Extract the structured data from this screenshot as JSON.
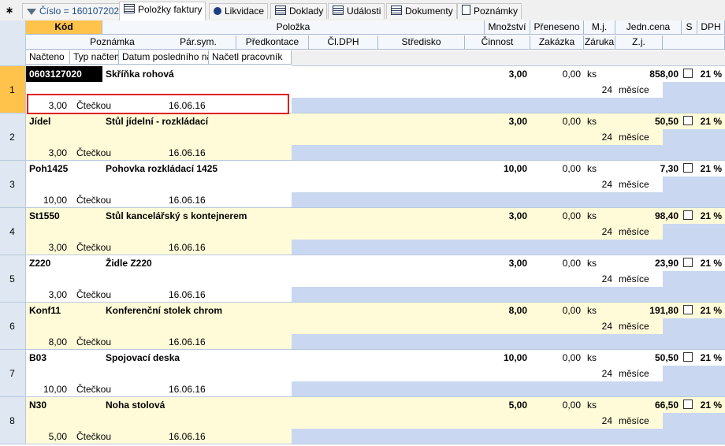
{
  "tabs": [
    {
      "label": "Číslo = 160107202",
      "icon": "funnel-icon"
    },
    {
      "label": "Položky faktury",
      "icon": "table-icon"
    },
    {
      "label": "Likvidace",
      "icon": "circle-icon"
    },
    {
      "label": "Doklady",
      "icon": "table-icon"
    },
    {
      "label": "Události",
      "icon": "table-icon"
    },
    {
      "label": "Dokumenty",
      "icon": "table-icon"
    },
    {
      "label": "Poznámky",
      "icon": "page-icon"
    }
  ],
  "corner_symbol": "∗",
  "header": {
    "row1": [
      "Kód",
      "Položka",
      "Množství",
      "Přeneseno",
      "M.j.",
      "Jedn.cena",
      "S",
      "DPH"
    ],
    "row2": [
      "Poznámka",
      "Pár.sym.",
      "Předkontace",
      "Čl.DPH",
      "Středisko",
      "Činnost",
      "Zakázka",
      "Záruka",
      "Z.j."
    ],
    "row3": [
      "Načteno",
      "Typ načtení",
      "Datum posledního načtení",
      "Načetl pracovník"
    ]
  },
  "records": [
    {
      "num": "1",
      "kod": "0603127020",
      "polozka": "Skříňka rohová",
      "mnozstvi": "3,00",
      "preneseno": "0,00",
      "mj": "ks",
      "cena": "858,00",
      "dph": "21 %",
      "zaruka": "24",
      "zj": "měsíce",
      "nacteno": "3,00",
      "typ": "Čtečkou",
      "datum": "16.06.16"
    },
    {
      "num": "2",
      "kod": "Jídel",
      "polozka": "Stůl jídelní - rozkládací",
      "mnozstvi": "3,00",
      "preneseno": "0,00",
      "mj": "ks",
      "cena": "50,50",
      "dph": "21 %",
      "zaruka": "24",
      "zj": "měsíce",
      "nacteno": "3,00",
      "typ": "Čtečkou",
      "datum": "16.06.16"
    },
    {
      "num": "3",
      "kod": "Poh1425",
      "polozka": "Pohovka rozkládací 1425",
      "mnozstvi": "10,00",
      "preneseno": "0,00",
      "mj": "ks",
      "cena": "7,30",
      "dph": "21 %",
      "zaruka": "24",
      "zj": "měsíce",
      "nacteno": "10,00",
      "typ": "Čtečkou",
      "datum": "16.06.16"
    },
    {
      "num": "4",
      "kod": "St1550",
      "polozka": "Stůl kancelářský s kontejnerem",
      "mnozstvi": "3,00",
      "preneseno": "0,00",
      "mj": "ks",
      "cena": "98,40",
      "dph": "21 %",
      "zaruka": "24",
      "zj": "měsíce",
      "nacteno": "3,00",
      "typ": "Čtečkou",
      "datum": "16.06.16"
    },
    {
      "num": "5",
      "kod": "Z220",
      "polozka": "Židle Z220",
      "mnozstvi": "3,00",
      "preneseno": "0,00",
      "mj": "ks",
      "cena": "23,90",
      "dph": "21 %",
      "zaruka": "24",
      "zj": "měsíce",
      "nacteno": "3,00",
      "typ": "Čtečkou",
      "datum": "16.06.16"
    },
    {
      "num": "6",
      "kod": "Konf11",
      "polozka": "Konferenční stolek chrom",
      "mnozstvi": "8,00",
      "preneseno": "0,00",
      "mj": "ks",
      "cena": "191,80",
      "dph": "21 %",
      "zaruka": "24",
      "zj": "měsíce",
      "nacteno": "8,00",
      "typ": "Čtečkou",
      "datum": "16.06.16"
    },
    {
      "num": "7",
      "kod": "B03",
      "polozka": "Spojovací deska",
      "mnozstvi": "10,00",
      "preneseno": "0,00",
      "mj": "ks",
      "cena": "50,50",
      "dph": "21 %",
      "zaruka": "24",
      "zj": "měsíce",
      "nacteno": "10,00",
      "typ": "Čtečkou",
      "datum": "16.06.16"
    },
    {
      "num": "8",
      "kod": "N30",
      "polozka": "Noha stolová",
      "mnozstvi": "5,00",
      "preneseno": "0,00",
      "mj": "ks",
      "cena": "66,50",
      "dph": "21 %",
      "zaruka": "24",
      "zj": "měsíce",
      "nacteno": "5,00",
      "typ": "Čtečkou",
      "datum": "16.06.16"
    }
  ],
  "colors": {
    "orange": "#ffc24a",
    "yellow_row": "#fffbd8",
    "blue_band": "#c9d8f0",
    "highlight": "#e02020"
  }
}
